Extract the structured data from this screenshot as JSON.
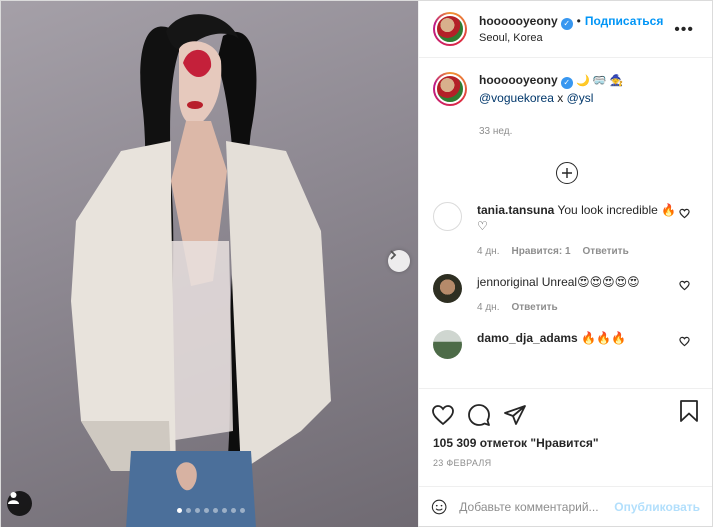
{
  "header": {
    "username": "hoooooyeony",
    "follow_label": "Подписаться",
    "location": "Seoul, Korea",
    "more_label": "•••"
  },
  "caption": {
    "username": "hoooooyeony",
    "emojis": "🌙 🥽 🧙",
    "mention_1": "@voguekorea",
    "separator": " x ",
    "mention_2": "@ysl",
    "time": "33 нед."
  },
  "comments": [
    {
      "username": "tania.tansuna",
      "text": "You look incredible 🔥 ♡",
      "time": "4 дн.",
      "likes": "Нравится: 1",
      "reply": "Ответить",
      "avatar_color": "#ffffff"
    },
    {
      "username": "jennoriginal",
      "text": "Unreal😍😍😍😍😍",
      "time": "4 дн.",
      "reply": "Ответить",
      "avatar_color": "#3a3b2e"
    },
    {
      "username": "damo_dja_adams",
      "text": "🔥🔥🔥",
      "avatar_color": "#4d6b48"
    }
  ],
  "likes_text": "105 309 отметок \"Нравится\"",
  "date_text": "23 ФЕВРАЛЯ",
  "comment_input": {
    "placeholder": "Добавьте комментарий...",
    "publish_label": "Опубликовать"
  },
  "carousel": {
    "dot_count": 8,
    "active_index": 0
  },
  "colors": {
    "link": "#0095f6",
    "verified": "#3897f0",
    "publish_disabled": "#b2dffc"
  }
}
